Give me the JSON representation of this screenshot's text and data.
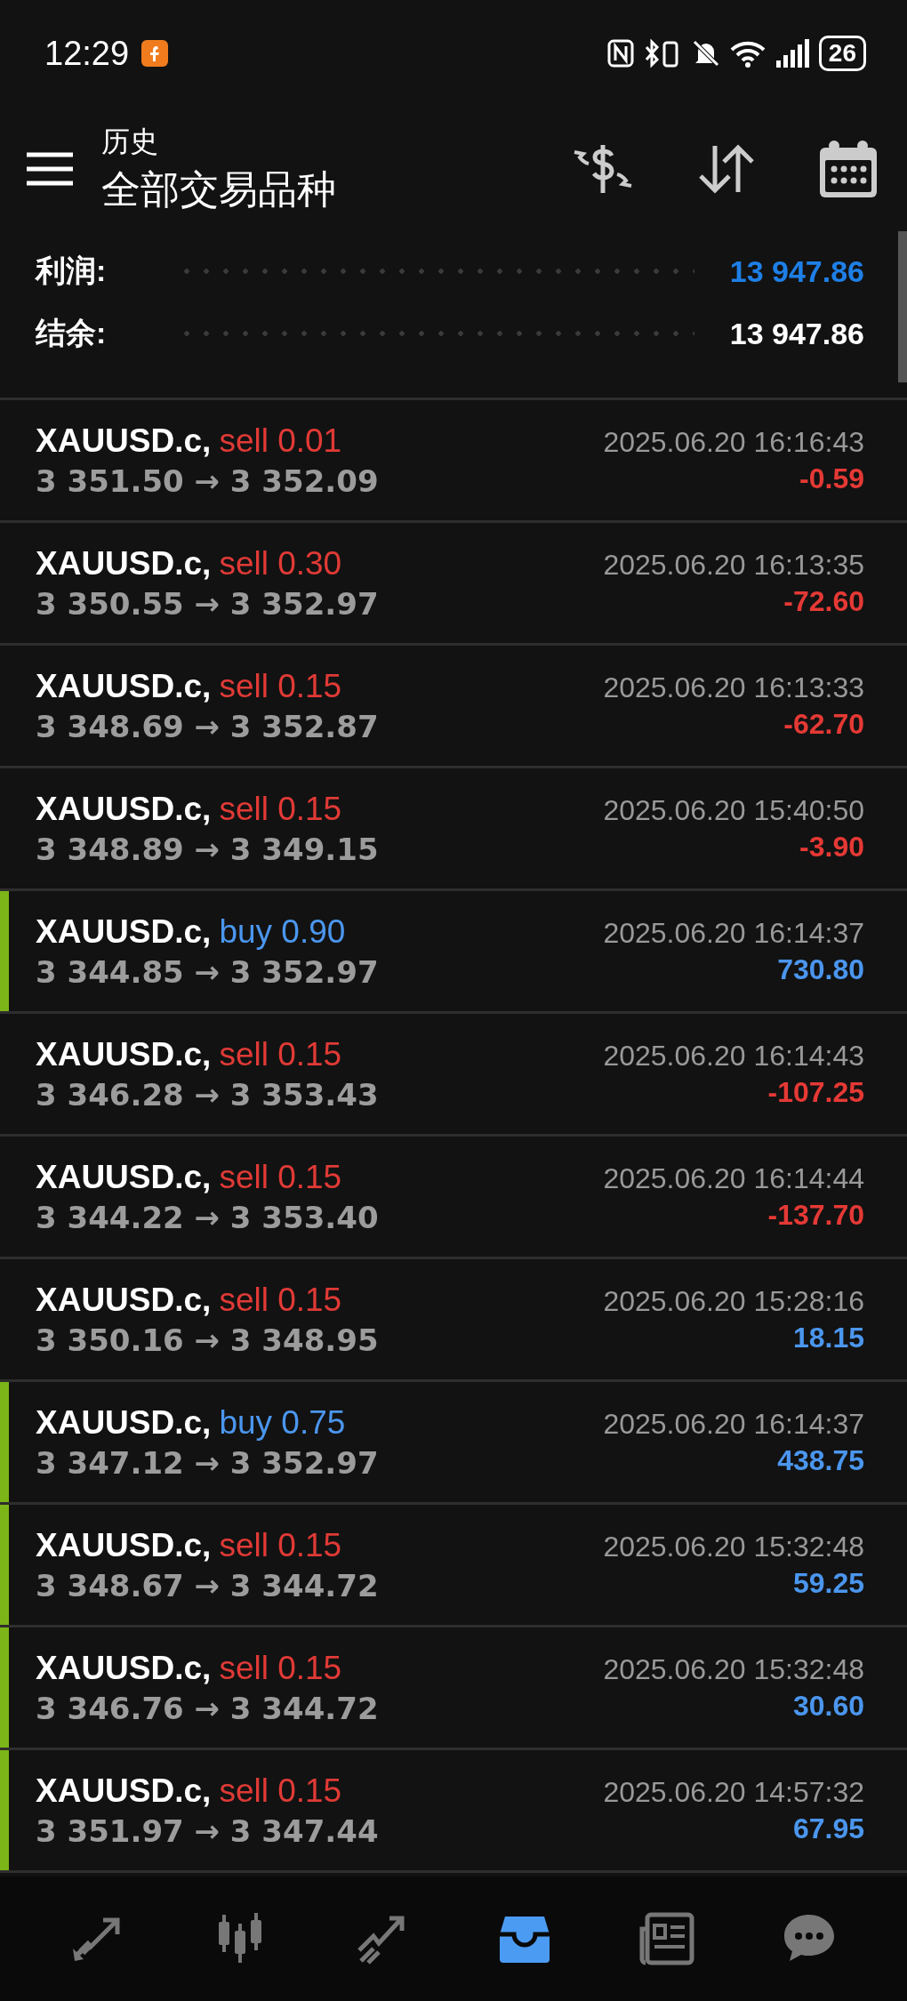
{
  "status_bar": {
    "time": "12:29",
    "battery": "26"
  },
  "header": {
    "title": "历史",
    "subtitle": "全部交易品种"
  },
  "summary": [
    {
      "label": "利润:",
      "value": "13 947.86",
      "kind": "profit"
    },
    {
      "label": "结余:",
      "value": "13 947.86",
      "kind": "balance"
    }
  ],
  "trades": [
    {
      "symbol": "XAUUSD.c,",
      "kind": "sell",
      "volume": "sell 0.01",
      "prices": "3 351.50 → 3 352.09",
      "time": "2025.06.20 16:16:43",
      "profit": "-0.59",
      "color": "#e53935",
      "marked": false
    },
    {
      "symbol": "XAUUSD.c,",
      "kind": "sell",
      "volume": "sell 0.30",
      "prices": "3 350.55 → 3 352.97",
      "time": "2025.06.20 16:13:35",
      "profit": "-72.60",
      "color": "#e53935",
      "marked": false
    },
    {
      "symbol": "XAUUSD.c,",
      "kind": "sell",
      "volume": "sell 0.15",
      "prices": "3 348.69 → 3 352.87",
      "time": "2025.06.20 16:13:33",
      "profit": "-62.70",
      "color": "#e53935",
      "marked": false
    },
    {
      "symbol": "XAUUSD.c,",
      "kind": "sell",
      "volume": "sell 0.15",
      "prices": "3 348.89 → 3 349.15",
      "time": "2025.06.20 15:40:50",
      "profit": "-3.90",
      "color": "#e53935",
      "marked": false
    },
    {
      "symbol": "XAUUSD.c,",
      "kind": "buy",
      "volume": "buy 0.90",
      "prices": "3 344.85 → 3 352.97",
      "time": "2025.06.20 16:14:37",
      "profit": "730.80",
      "color": "#4b96ee",
      "marked": true
    },
    {
      "symbol": "XAUUSD.c,",
      "kind": "sell",
      "volume": "sell 0.15",
      "prices": "3 346.28 → 3 353.43",
      "time": "2025.06.20 16:14:43",
      "profit": "-107.25",
      "color": "#e53935",
      "marked": false
    },
    {
      "symbol": "XAUUSD.c,",
      "kind": "sell",
      "volume": "sell 0.15",
      "prices": "3 344.22 → 3 353.40",
      "time": "2025.06.20 16:14:44",
      "profit": "-137.70",
      "color": "#e53935",
      "marked": false
    },
    {
      "symbol": "XAUUSD.c,",
      "kind": "sell",
      "volume": "sell 0.15",
      "prices": "3 350.16 → 3 348.95",
      "time": "2025.06.20 15:28:16",
      "profit": "18.15",
      "color": "#4b96ee",
      "marked": false
    },
    {
      "symbol": "XAUUSD.c,",
      "kind": "buy",
      "volume": "buy 0.75",
      "prices": "3 347.12 → 3 352.97",
      "time": "2025.06.20 16:14:37",
      "profit": "438.75",
      "color": "#4b96ee",
      "marked": true
    },
    {
      "symbol": "XAUUSD.c,",
      "kind": "sell",
      "volume": "sell 0.15",
      "prices": "3 348.67 → 3 344.72",
      "time": "2025.06.20 15:32:48",
      "profit": "59.25",
      "color": "#4b96ee",
      "marked": true
    },
    {
      "symbol": "XAUUSD.c,",
      "kind": "sell",
      "volume": "sell 0.15",
      "prices": "3 346.76 → 3 344.72",
      "time": "2025.06.20 15:32:48",
      "profit": "30.60",
      "color": "#4b96ee",
      "marked": true
    },
    {
      "symbol": "XAUUSD.c,",
      "kind": "sell",
      "volume": "sell 0.15",
      "prices": "3 351.97 → 3 347.44",
      "time": "2025.06.20 14:57:32",
      "profit": "67.95",
      "color": "#4b96ee",
      "marked": true
    }
  ],
  "nav": [
    {
      "kind": "trade",
      "selected": false
    },
    {
      "kind": "chart",
      "selected": false
    },
    {
      "kind": "trend",
      "selected": false
    },
    {
      "kind": "history",
      "selected": true
    },
    {
      "kind": "news",
      "selected": false
    },
    {
      "kind": "chat",
      "selected": false
    }
  ]
}
